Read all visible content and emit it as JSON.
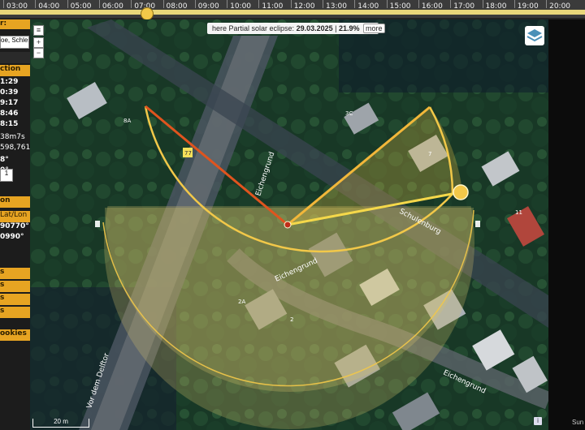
{
  "timeline": {
    "hours": [
      "03:00",
      "04:00",
      "05:00",
      "06:00",
      "07:00",
      "08:00",
      "09:00",
      "10:00",
      "11:00",
      "12:00",
      "13:00",
      "14:00",
      "15:00",
      "16:00",
      "17:00",
      "18:00",
      "19:00",
      "20:00"
    ]
  },
  "banner": {
    "prefix": "here Partial solar eclipse:",
    "date": "29.03.2025",
    "separator": " | ",
    "magnitude": "21.9%",
    "more_label": "more"
  },
  "left_panel": {
    "search_value": "oe, Schles",
    "section1_label": "ction",
    "times": [
      "1:29",
      "0:39",
      "9:17",
      "8:46",
      "8:15"
    ],
    "value1": "38m7s",
    "value2": "598,761",
    "deg1": "8°",
    "deg2": "0°",
    "input_small": "1",
    "section2_label": "on",
    "latlon_label": "Lat/Lon",
    "lat": "90770°",
    "lon": "0990°",
    "cookies_label": "ookies",
    "r1": "s",
    "r2": "s",
    "r3": "s",
    "r4": "s"
  },
  "map": {
    "streets": [
      "Eichengrund",
      "Eichengrund",
      "Eichengrund",
      "Schulenburg",
      "Vor dem Delftor"
    ],
    "house_numbers": [
      "8A",
      "3C",
      "7",
      "11",
      "2A",
      "2",
      "77"
    ],
    "scale_label": "20 m",
    "accent": "#f2c849",
    "sunrise_line_color": "#e0541e",
    "sun_line_color": "#f5d84a"
  },
  "right_panel": {
    "logo_text": "Sun"
  }
}
